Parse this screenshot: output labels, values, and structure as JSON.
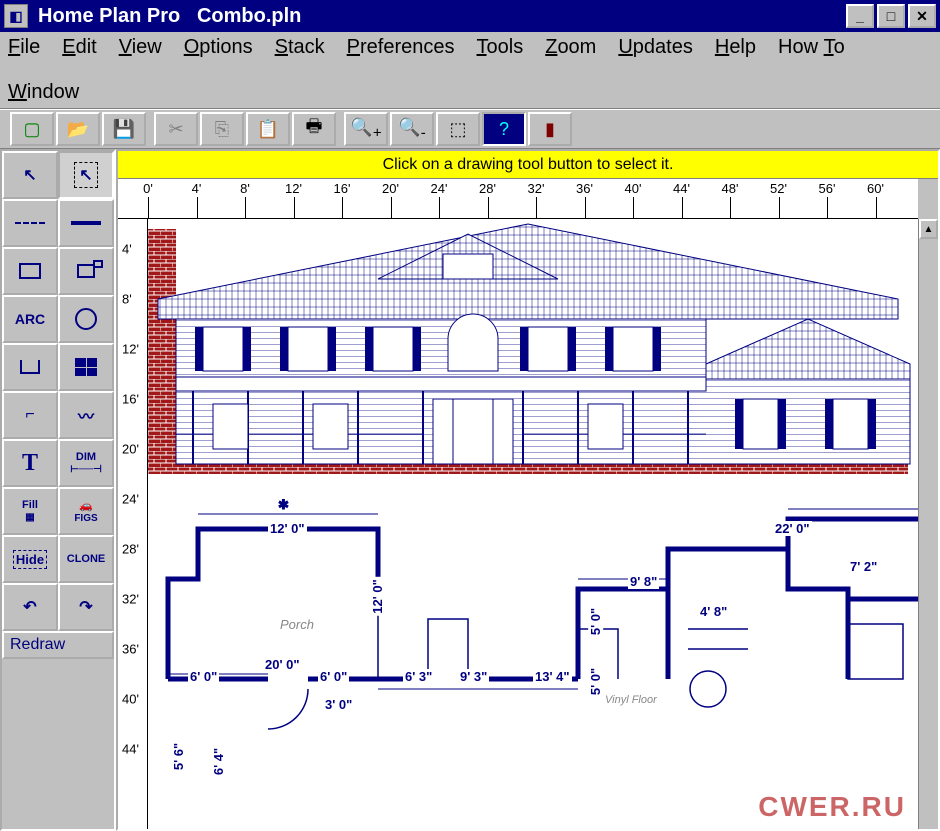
{
  "title": {
    "app": "Home Plan Pro",
    "file": "Combo.pln"
  },
  "menus": [
    "File",
    "Edit",
    "View",
    "Options",
    "Stack",
    "Preferences",
    "Tools",
    "Zoom",
    "Updates",
    "Help",
    "How To",
    "Window"
  ],
  "menu_accel": [
    0,
    0,
    0,
    0,
    0,
    0,
    0,
    0,
    0,
    0,
    3,
    0
  ],
  "toolbar_icons": [
    "new",
    "open",
    "save",
    "cut",
    "copy",
    "paste",
    "print",
    "zoom-in",
    "zoom-out",
    "zoom-window",
    "help",
    "exit"
  ],
  "hint": "Click on a drawing tool button to select it.",
  "ruler_h": [
    "0'",
    "4'",
    "8'",
    "12'",
    "16'",
    "20'",
    "24'",
    "28'",
    "32'",
    "36'",
    "40'",
    "44'",
    "48'",
    "52'",
    "56'",
    "60'"
  ],
  "ruler_v": [
    "4'",
    "8'",
    "12'",
    "16'",
    "20'",
    "24'",
    "28'",
    "32'",
    "36'",
    "40'",
    "44'"
  ],
  "tools": [
    [
      "pointer",
      "select-rect"
    ],
    [
      "line-dashed",
      "line-solid"
    ],
    [
      "rectangle",
      "polygon"
    ],
    [
      "arc",
      "circle"
    ],
    [
      "shape-u",
      "grid"
    ],
    [
      "curve",
      "wave"
    ],
    [
      "text",
      "dim"
    ],
    [
      "fill",
      "figs"
    ],
    [
      "hide",
      "clone"
    ],
    [
      "undo",
      "redo"
    ]
  ],
  "tool_labels": {
    "arc": "ARC",
    "text": "T",
    "dim": "DIM",
    "fill": "Fill",
    "figs": "FIGS",
    "hide": "Hide",
    "clone": "CLONE"
  },
  "redraw": "Redraw",
  "dims": {
    "a": "12' 0\"",
    "b": "12' 0\"",
    "c": "20' 0\"",
    "d": "6' 0\"",
    "e": "6' 0\"",
    "f": "3' 0\"",
    "g": "6' 3\"",
    "h": "9' 3\"",
    "i": "13' 4\"",
    "j": "9' 8\"",
    "k": "4' 8\"",
    "l": "22' 0\"",
    "m": "7' 2\"",
    "n": "5' 0\"",
    "o": "5' 0\"",
    "p": "5' 6\"",
    "q": "6' 4\"",
    "r": "Porch",
    "s": "Vinyl Floor"
  },
  "watermark": "CWER.RU"
}
